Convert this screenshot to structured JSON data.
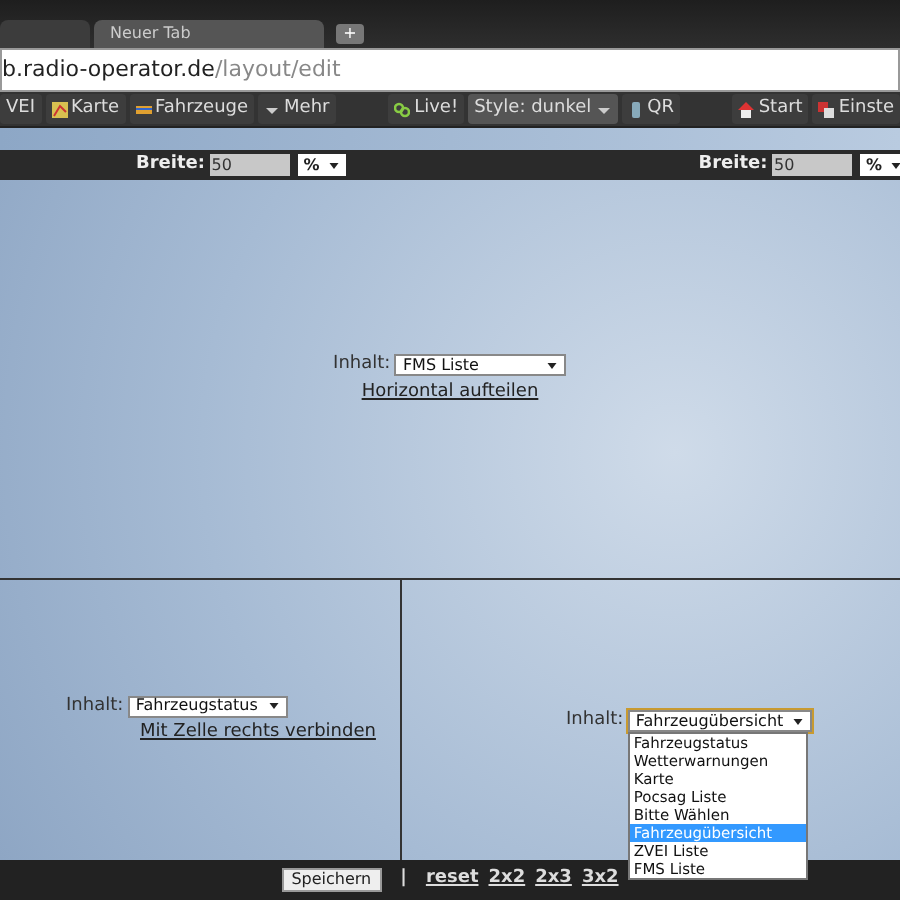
{
  "browser": {
    "tabs": [
      {
        "selected": false
      },
      {
        "label": "Neuer Tab",
        "selected": true
      }
    ],
    "new_tab": "+",
    "address": {
      "host": "b.radio-operator.de",
      "path": "/layout/edit"
    }
  },
  "toolbar": {
    "left": [
      {
        "label": "VEI"
      },
      {
        "label": "Karte"
      },
      {
        "label": "Fahrzeuge"
      },
      {
        "label": "Mehr"
      }
    ],
    "center": [
      {
        "label": "Live!"
      },
      {
        "label": "Style: dunkel"
      },
      {
        "label": "QR"
      }
    ],
    "right": [
      {
        "label": "Start"
      },
      {
        "label": "Einste"
      }
    ]
  },
  "width_bar": [
    {
      "label": "Breite:",
      "value": "50",
      "unit": "%"
    },
    {
      "label": "Breite:",
      "value": "50",
      "unit": "%"
    }
  ],
  "cells": [
    {
      "content_label": "Inhalt:",
      "content_value": "FMS Liste",
      "link": "Horizontal aufteilen",
      "open": false
    },
    {
      "content_label": "Inhalt:",
      "content_value": "Fahrzeugstatus",
      "link": "Mit Zelle rechts verbinden",
      "open": false
    },
    {
      "content_label": "Inhalt:",
      "content_value": "Fahrzeugübersicht",
      "open": true,
      "options": [
        {
          "label": "Fahrzeugstatus",
          "selected": false
        },
        {
          "label": "Wetterwarnungen",
          "selected": false
        },
        {
          "label": "Karte",
          "selected": false
        },
        {
          "label": "Pocsag Liste",
          "selected": false
        },
        {
          "label": "Bitte Wählen",
          "selected": false
        },
        {
          "label": "Fahrzeugübersicht",
          "selected": true
        },
        {
          "label": "ZVEI Liste",
          "selected": false
        },
        {
          "label": "FMS Liste",
          "selected": false
        }
      ]
    }
  ],
  "footer": {
    "save": "Speichern",
    "separator": "|",
    "links": [
      "reset",
      "2x2",
      "2x3",
      "3x2"
    ]
  }
}
